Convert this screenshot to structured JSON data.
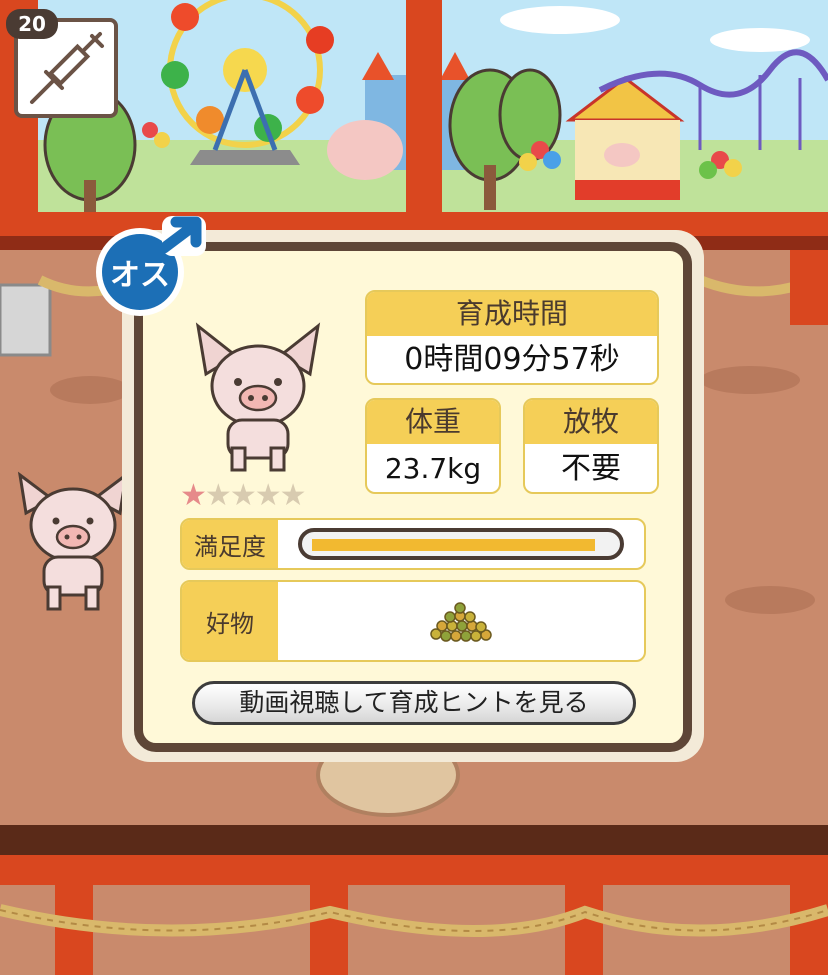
{
  "item": {
    "count": "20",
    "icon": "syringe-icon"
  },
  "gender": {
    "label": "オス",
    "icon": "male-symbol-icon",
    "color": "#1c6fb6"
  },
  "pig": {
    "rating": 1,
    "rating_max": 5
  },
  "stats": {
    "time_label": "育成時間",
    "time_value": "0時間09分57秒",
    "weight_label": "体重",
    "weight_value": "23.7kg",
    "grazing_label": "放牧",
    "grazing_value": "不要"
  },
  "satisfaction": {
    "label": "満足度",
    "level": 0.95
  },
  "favorite": {
    "label": "好物",
    "icon": "grain-pile-icon"
  },
  "hint_button": {
    "label": "動画視聴して育成ヒントを見る"
  },
  "colors": {
    "accent": "#f5cf57",
    "panel_border": "#5e4637",
    "frame_red": "#d9471f"
  }
}
